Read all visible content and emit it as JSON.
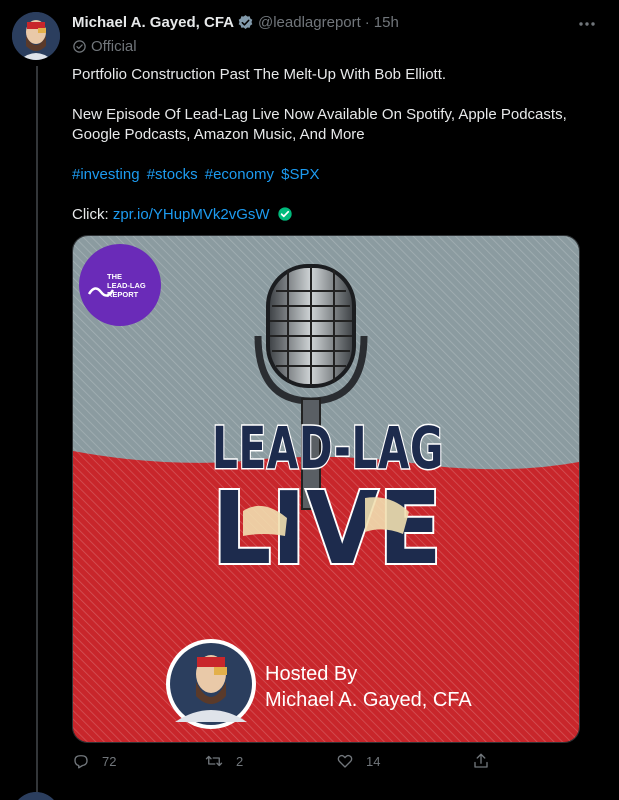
{
  "author": {
    "name": "Michael A. Gayed, CFA",
    "handle": "@leadlagreport",
    "separator": "·",
    "time": "15h",
    "label": "Official"
  },
  "tweet": {
    "line1": "Portfolio Construction Past The Melt-Up With Bob Elliott.",
    "line2": "New Episode Of Lead-Lag Live Now Available On Spotify, Apple Podcasts, Google Podcasts, Amazon Music, And More",
    "hashtags": [
      "#investing",
      "#stocks",
      "#economy",
      "$SPX"
    ],
    "click_label": "Click:",
    "link": "zpr.io/YHupMVk2vGsW"
  },
  "media": {
    "logo_line1": "THE",
    "logo_line2": "LEAD-LAG",
    "logo_line3": "REPORT",
    "title_line1": "LEAD-LAG",
    "title_line2": "LIVE",
    "hosted_by": "Hosted By",
    "host_name": "Michael A. Gayed, CFA"
  },
  "actions": {
    "replies": "72",
    "retweets": "2",
    "likes": "14"
  },
  "colors": {
    "accent": "#1d9bf0",
    "verified_badge": "#7a8087",
    "official_link_check": "#00ba7c",
    "poster_red": "#c8262b",
    "poster_gray": "#8b9ba0",
    "poster_navy": "#1d2b4d",
    "logo_purple": "#6a2bb8"
  }
}
